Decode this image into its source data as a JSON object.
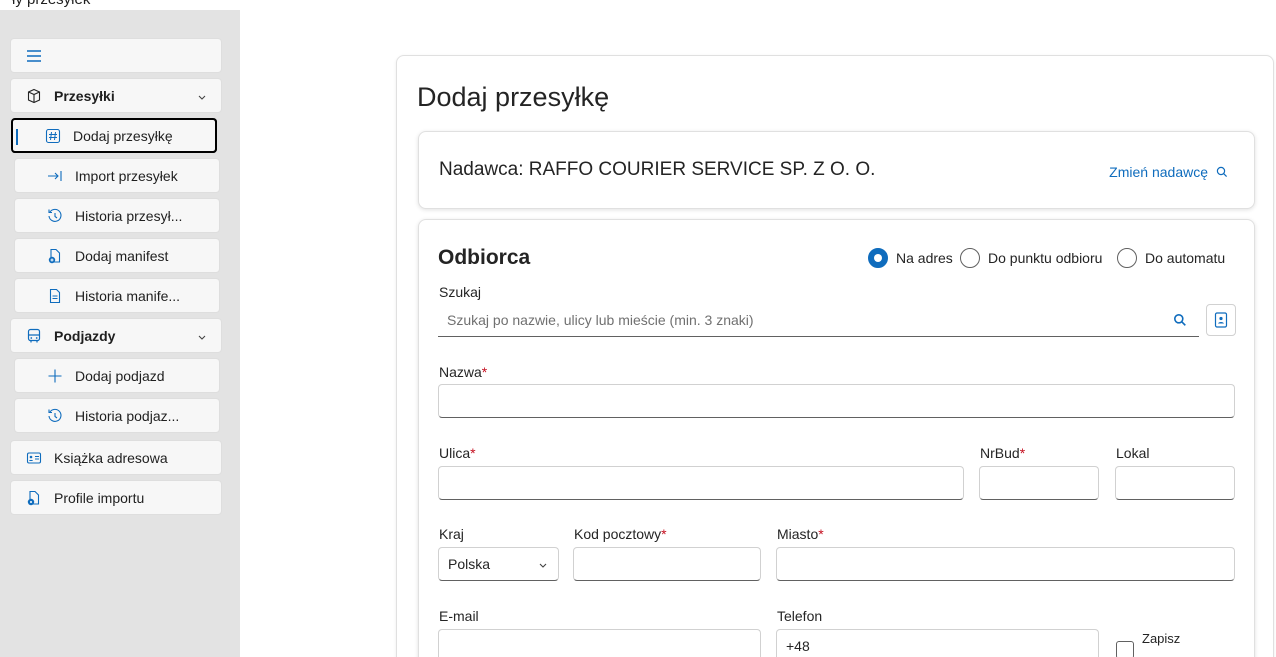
{
  "top_partial_text": "ły przesyłek",
  "sidebar": {
    "menu_icon": "hamburger-icon",
    "groups": [
      {
        "label": "Przesyłki",
        "icon": "package-icon"
      },
      {
        "label": "Podjazdy",
        "icon": "bus-icon"
      }
    ],
    "items": [
      {
        "label": "Dodaj przesyłkę",
        "icon": "hash-icon",
        "selected": true
      },
      {
        "label": "Import przesyłek",
        "icon": "import-arrow-icon"
      },
      {
        "label": "Historia przesył...",
        "icon": "history-icon"
      },
      {
        "label": "Dodaj manifest",
        "icon": "document-add-icon"
      },
      {
        "label": "Historia manife...",
        "icon": "document-icon"
      },
      {
        "label": "Dodaj podjazd",
        "icon": "plus-icon"
      },
      {
        "label": "Historia podjaz...",
        "icon": "history-icon"
      },
      {
        "label": "Książka adresowa",
        "icon": "contact-card-icon"
      },
      {
        "label": "Profile importu",
        "icon": "document-settings-icon"
      }
    ]
  },
  "main": {
    "title": "Dodaj przesyłkę",
    "sender": {
      "text": "Nadawca: RAFFO COURIER SERVICE SP. Z O. O.",
      "change_link": "Zmień nadawcę"
    },
    "recipient": {
      "title": "Odbiorca",
      "options": [
        {
          "label": "Na adres",
          "checked": true
        },
        {
          "label": "Do punktu odbioru",
          "checked": false
        },
        {
          "label": "Do automatu",
          "checked": false
        }
      ],
      "search_label": "Szukaj",
      "search_placeholder": "Szukaj po nazwie, ulicy lub mieście (min. 3 znaki)",
      "name_label": "Nazwa",
      "street_label": "Ulica",
      "building_label": "NrBud",
      "apartment_label": "Lokal",
      "country_label": "Kraj",
      "country_value": "Polska",
      "postal_label": "Kod pocztowy",
      "city_label": "Miasto",
      "email_label": "E-mail",
      "phone_label": "Telefon",
      "phone_value": "+48",
      "save_label": "Zapisz",
      "required_mark": "*"
    }
  },
  "colors": {
    "accent": "#0f6cbd",
    "required": "#c50f1f",
    "sidebar_bg": "#e3e3e3"
  }
}
